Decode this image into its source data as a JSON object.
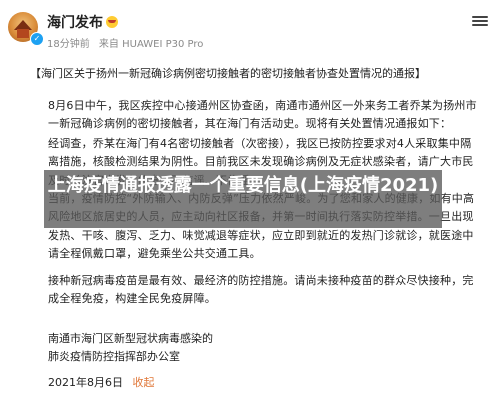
{
  "post": {
    "author": "海门发布",
    "time": "18分钟前",
    "source": "来自 HUAWEI P30 Pro",
    "title": "【海门区关于扬州一新冠确诊病例密切接触者的密切接触者协查处置情况的通报】",
    "paragraphs": [
      "8月6日中午，我区疾控中心接通州区协查函，南通市通州区一外来务工者乔某为扬州市一新冠确诊病例的密切接触者，其在海门有活动史。现将有关处置情况通报如下：",
      "经调查，乔某在海门有4名密切接触者（次密接），我区已按防控要求对4人采取集中隔离措施，核酸检测结果为阴性。目前我区未发现确诊病例及无症状感染者，请广大市民及时关注官方发布信息，不信谣、不传谣。",
      "当前，疫情防控“外防输入、内防反弹”压力依然严峻。为了您和家人的健康，如有中高风险地区旅居史的人员，应主动向社区报备，并第一时间执行落实防控举措。一旦出现发热、干咳、腹泻、乏力、味觉减退等症状，应立即到就近的发热门诊就诊，就医途中请全程佩戴口罩，避免乘坐公共交通工具。",
      "接种新冠病毒疫苗是最有效、最经济的防控措施。请尚未接种疫苗的群众尽快接种，完成全程免疫，构建全民免疫屏障。"
    ],
    "sign_lines": [
      "南通市海门区新型冠状病毒感染的",
      "肺炎疫情防控指挥部办公室"
    ],
    "date": "2021年8月6日",
    "collapse_label": "收起"
  },
  "overlay": {
    "headline": "上海疫情通报透露一个重要信息(上海疫情2021)"
  },
  "colors": {
    "link": "#e0783a",
    "verified": "#1da1f2",
    "meta": "#8a8a8a"
  }
}
